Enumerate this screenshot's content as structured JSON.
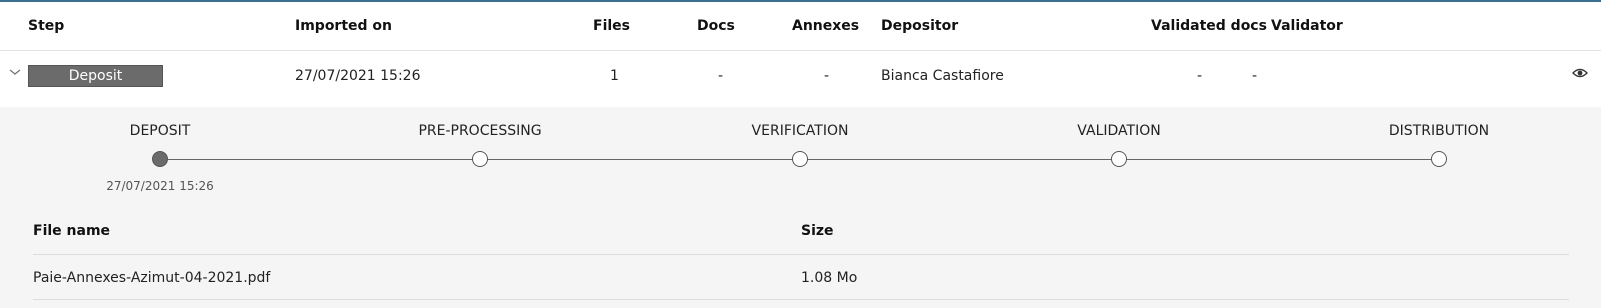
{
  "table": {
    "headers": {
      "step": "Step",
      "imported_on": "Imported on",
      "files": "Files",
      "docs": "Docs",
      "annexes": "Annexes",
      "depositor": "Depositor",
      "validated_docs": "Validated docs",
      "validator": "Validator"
    },
    "row": {
      "step": "Deposit",
      "imported_on": "27/07/2021 15:26",
      "files": "1",
      "docs": "-",
      "annexes": "-",
      "depositor": "Bianca Castafiore",
      "validated_docs": "-",
      "validator": "-"
    }
  },
  "timeline": {
    "steps": [
      {
        "label": "DEPOSIT",
        "state": "done",
        "date": "27/07/2021 15:26"
      },
      {
        "label": "PRE-PROCESSING",
        "state": "pending"
      },
      {
        "label": "VERIFICATION",
        "state": "pending"
      },
      {
        "label": "VALIDATION",
        "state": "pending"
      },
      {
        "label": "DISTRIBUTION",
        "state": "pending"
      }
    ]
  },
  "files": {
    "headers": {
      "file_name": "File name",
      "size": "Size"
    },
    "rows": [
      {
        "file_name": "Paie-Annexes-Azimut-04-2021.pdf",
        "size": "1.08 Mo"
      }
    ]
  },
  "icons": {
    "expand": "chevron-down-icon",
    "view": "eye-icon"
  },
  "colors": {
    "accent": "#3b6e8f",
    "badge": "#6b6b6b",
    "detail_bg": "#f5f5f5"
  }
}
